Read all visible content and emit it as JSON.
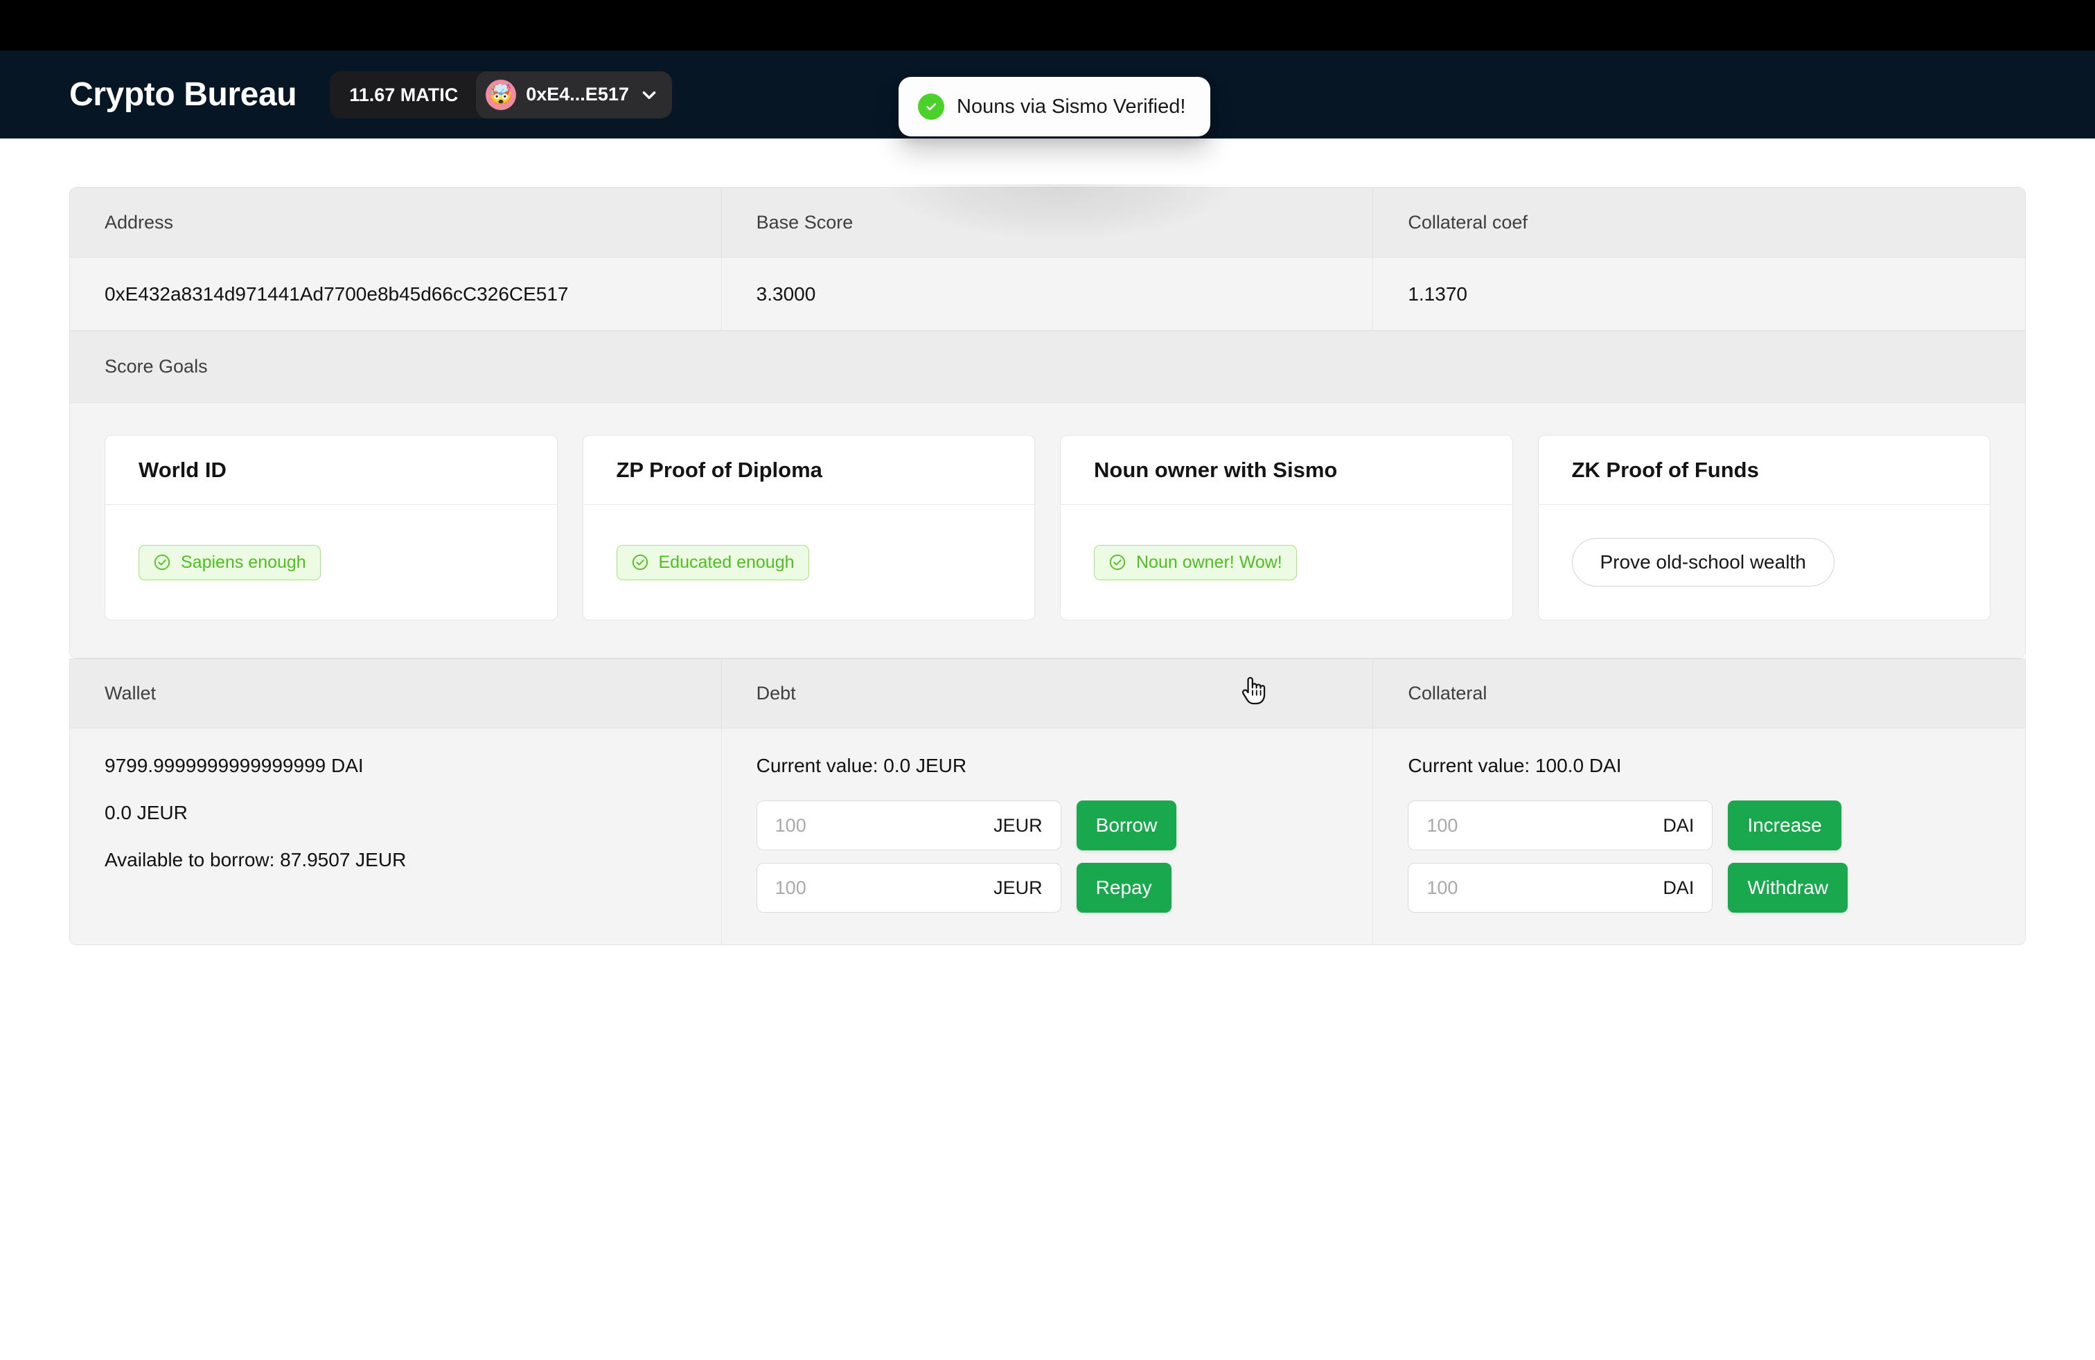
{
  "header": {
    "brand": "Crypto Bureau",
    "matic_balance": "11.67 MATIC",
    "account_short": "0xE4...E517",
    "avatar_emoji": "🤯",
    "chevron_icon": "chevron-down-icon"
  },
  "toast": {
    "message": "Nouns via Sismo Verified!",
    "icon": "check-circle-icon",
    "icon_color": "#4ad22b"
  },
  "account_table": {
    "headers": [
      "Address",
      "Base Score",
      "Collateral coef"
    ],
    "values": [
      "0xE432a8314d971441Ad7700e8b45d66cC326CE517",
      "3.3000",
      "1.1370"
    ]
  },
  "score_goals": {
    "section_label": "Score Goals",
    "cards": [
      {
        "title": "World ID",
        "badge": "Sapiens enough",
        "type": "badge"
      },
      {
        "title": "ZP Proof of Diploma",
        "badge": "Educated enough",
        "type": "badge"
      },
      {
        "title": "Noun owner with Sismo",
        "badge": "Noun owner! Wow!",
        "type": "badge"
      },
      {
        "title": "ZK Proof of Funds",
        "button": "Prove old-school wealth",
        "type": "button"
      }
    ]
  },
  "positions": {
    "headers": [
      "Wallet",
      "Debt",
      "Collateral"
    ],
    "wallet": {
      "dai_balance": "9799.9999999999999999 DAI",
      "jeur_balance": "0.0 JEUR",
      "available": "Available to borrow: 87.9507 JEUR"
    },
    "debt": {
      "current_value": "Current value: 0.0 JEUR",
      "rows": [
        {
          "placeholder": "100",
          "unit": "JEUR",
          "action": "Borrow"
        },
        {
          "placeholder": "100",
          "unit": "JEUR",
          "action": "Repay"
        }
      ]
    },
    "collateral": {
      "current_value": "Current value: 100.0 DAI",
      "rows": [
        {
          "placeholder": "100",
          "unit": "DAI",
          "action": "Increase"
        },
        {
          "placeholder": "100",
          "unit": "DAI",
          "action": "Withdraw"
        }
      ]
    }
  },
  "colors": {
    "navbar_bg": "#071624",
    "green_action": "#1aa84f",
    "badge_green": "#4fbd24"
  }
}
